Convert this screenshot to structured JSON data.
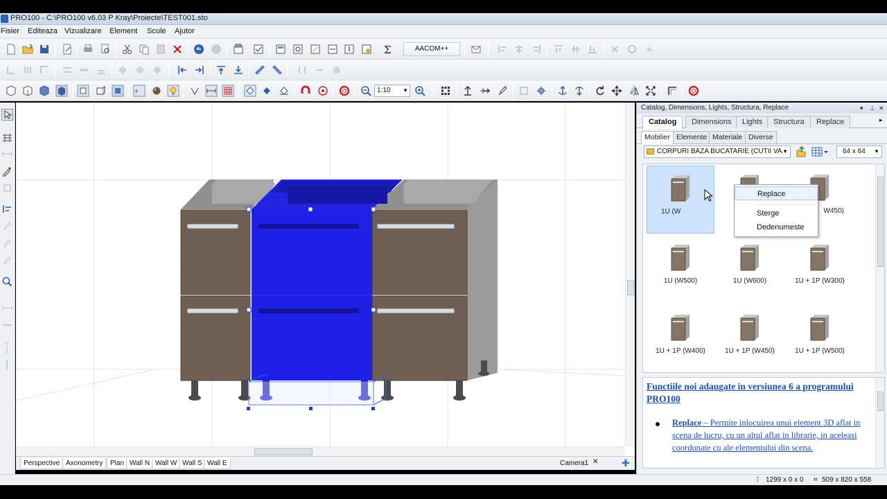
{
  "window": {
    "title": "PRO100 - C:\\PRO100 v6.03 P Kray\\Proiecte\\TEST001.sto"
  },
  "menu": [
    "Fisier",
    "Editeaza",
    "Vizualizare",
    "Element",
    "Scule",
    "Ajutor"
  ],
  "toolbar": {
    "aacom_label": "AACOM++",
    "scale_value": "1:10"
  },
  "view_tabs": [
    "Perspective",
    "Axonometry",
    "Plan",
    "Wall N",
    "Wall W",
    "Wall S",
    "Wall E"
  ],
  "camera_tab": "Camera1",
  "status": {
    "coords": "1299 x 0 x 0",
    "size": "509 x 820 x 558"
  },
  "panel": {
    "header": "Catalog, Dimensions, Lights, Structura, Replace",
    "tabs": [
      "Catalog",
      "Dimensions",
      "Lights",
      "Structura",
      "Replace"
    ],
    "active_tab": "Catalog",
    "subtabs": [
      "Mobilier",
      "Elemente",
      "Materiale",
      "Diverse"
    ],
    "category": "CORPURI BAZA BUCATARIE (CUTII VA",
    "thumb_size": "64 x  64",
    "items": [
      {
        "label": "1U (W",
        "selected": true
      },
      {
        "label": "",
        "selected": false
      },
      {
        "label": "W450)",
        "selected": false
      },
      {
        "label": "1U (W500)",
        "selected": false
      },
      {
        "label": "1U (W600)",
        "selected": false
      },
      {
        "label": "1U + 1P (W300)",
        "selected": false
      },
      {
        "label": "1U + 1P (W400)",
        "selected": false
      },
      {
        "label": "1U + 1P (W450)",
        "selected": false
      },
      {
        "label": "1U + 1P (W500)",
        "selected": false
      }
    ]
  },
  "context_menu": {
    "items": [
      "Replace",
      "Sterge",
      "Dedenumeste"
    ],
    "highlighted": "Replace"
  },
  "info": {
    "heading": "Functiile noi adaugate in versiunea 6 a programului PRO100",
    "bullet_title": "Replace",
    "bullet_text": " – Permite inlocuirea unui element 3D aflat in scena de lucru, cu un altul aflat in librarie, in aceleasi coordonate cu ale elementului din scena."
  },
  "colors": {
    "selection": "#1f1fe6",
    "wood": "#6e5f52",
    "carcass": "#a6a7a5"
  }
}
